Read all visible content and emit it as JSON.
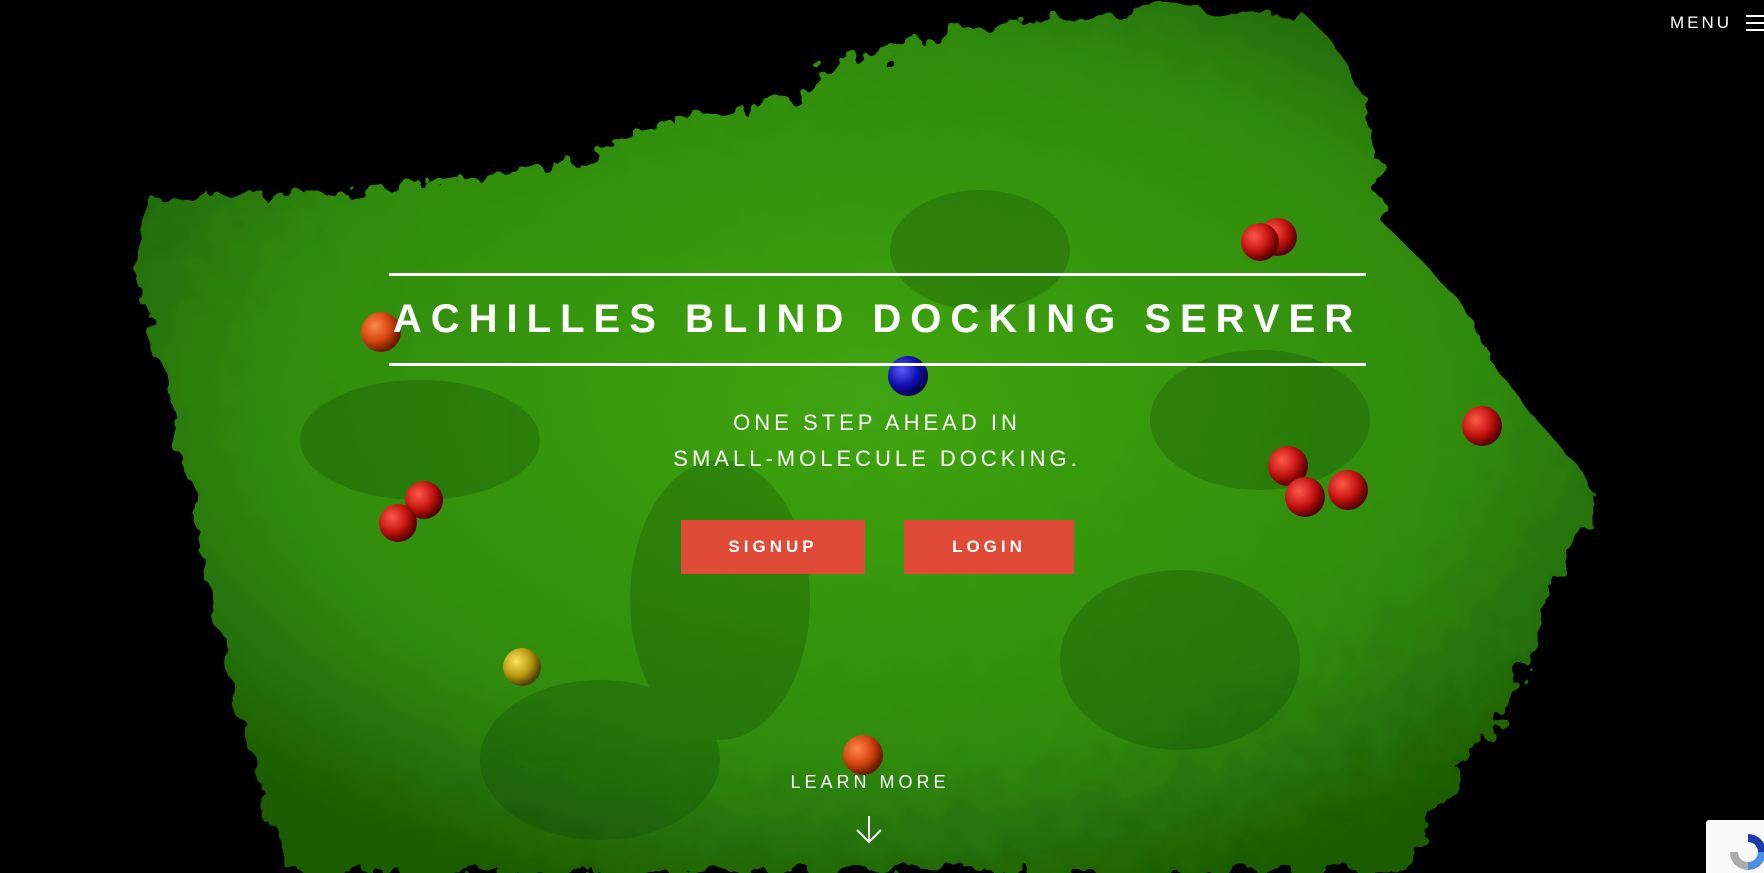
{
  "menu": {
    "label": "MENU",
    "icon": "hamburger-icon"
  },
  "hero": {
    "title": "ACHILLES BLIND DOCKING SERVER",
    "subtitle_line1": "ONE STEP AHEAD IN",
    "subtitle_line2": "SMALL-MOLECULE DOCKING.",
    "background": "green protein surface with red, blue and yellow atom spheres on black"
  },
  "buttons": {
    "signup": "SIGNUP",
    "login": "LOGIN"
  },
  "learn_more": {
    "label": "LEARN MORE",
    "icon": "arrow-down-icon"
  },
  "badge": {
    "icon": "recaptcha-icon"
  },
  "colors": {
    "background": "#000000",
    "protein": "#3a9a0f",
    "button": "#e04b37",
    "text": "#ffffff"
  }
}
